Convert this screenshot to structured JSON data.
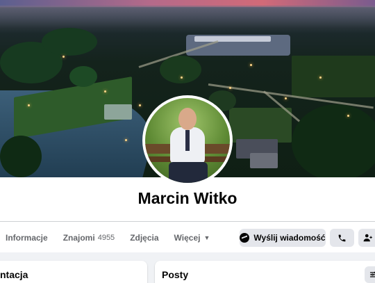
{
  "profile": {
    "name": "Marcin Witko"
  },
  "tabs": [
    {
      "label": "Informacje"
    },
    {
      "label": "Znajomi",
      "count": "4955"
    },
    {
      "label": "Zdjęcia"
    },
    {
      "label": "Więcej"
    }
  ],
  "actions": {
    "message_label": "Wyślij wiadomość",
    "message_icon": "messenger-icon",
    "call_icon": "phone-icon",
    "more_icon": "add-friend-icon"
  },
  "cards": {
    "left_title": "ntacja",
    "right_title": "Posty",
    "filter_icon": "filter-icon"
  },
  "colors": {
    "page_bg": "#f0f2f5",
    "button_bg": "#e4e6eb",
    "text_primary": "#050505",
    "text_secondary": "#65676b"
  }
}
